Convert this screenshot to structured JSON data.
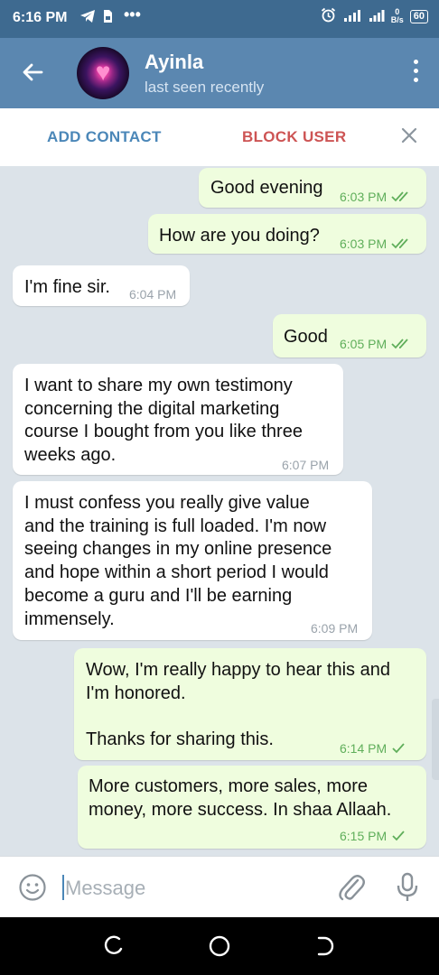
{
  "status_bar": {
    "time": "6:16 PM",
    "more": "•••",
    "speed_value": "0",
    "speed_unit": "B/s",
    "battery": "60"
  },
  "header": {
    "contact_name": "Ayinla",
    "last_seen": "last seen recently"
  },
  "action_bar": {
    "add_contact": "ADD CONTACT",
    "block_user": "BLOCK USER"
  },
  "messages": [
    {
      "direction": "out",
      "text": "Good evening",
      "time": "6:03 PM",
      "status": "read"
    },
    {
      "direction": "out",
      "text": "How are you doing?",
      "time": "6:03 PM",
      "status": "read"
    },
    {
      "direction": "in",
      "text": "I'm fine sir.",
      "time": "6:04 PM"
    },
    {
      "direction": "out",
      "text": "Good",
      "time": "6:05 PM",
      "status": "read"
    },
    {
      "direction": "in",
      "text": "I want to share my own testimony\nconcerning the digital marketing\ncourse I bought from you like three\nweeks ago.",
      "time": "6:07 PM"
    },
    {
      "direction": "in",
      "text": "I must confess you really give value\nand the training is full loaded. I'm now\nseeing changes in my online presence\nand hope within a short period I would\nbecome a guru and I'll be earning\nimmensely.",
      "time": "6:09 PM"
    },
    {
      "direction": "out",
      "text": "Wow, I'm really happy to hear this and\nI'm honored.\n\nThanks for sharing this.",
      "time": "6:14 PM",
      "status": "sent"
    },
    {
      "direction": "out",
      "text": "More customers, more sales, more\nmoney, more success. In shaa Allaah.",
      "time": "6:15 PM",
      "status": "sent"
    }
  ],
  "input": {
    "placeholder": "Message"
  },
  "colors": {
    "header": "#5b87b0",
    "status_bar": "#3e6a90",
    "outgoing_bubble": "#effdde",
    "incoming_bubble": "#ffffff",
    "check_green": "#5fae5a",
    "add_contact_blue": "#4b87b8",
    "block_user_red": "#cd5454"
  },
  "icons": [
    "back-arrow-icon",
    "more-vertical-icon",
    "close-icon",
    "emoji-icon",
    "attach-icon",
    "mic-icon",
    "double-check-icon",
    "single-check-icon"
  ]
}
